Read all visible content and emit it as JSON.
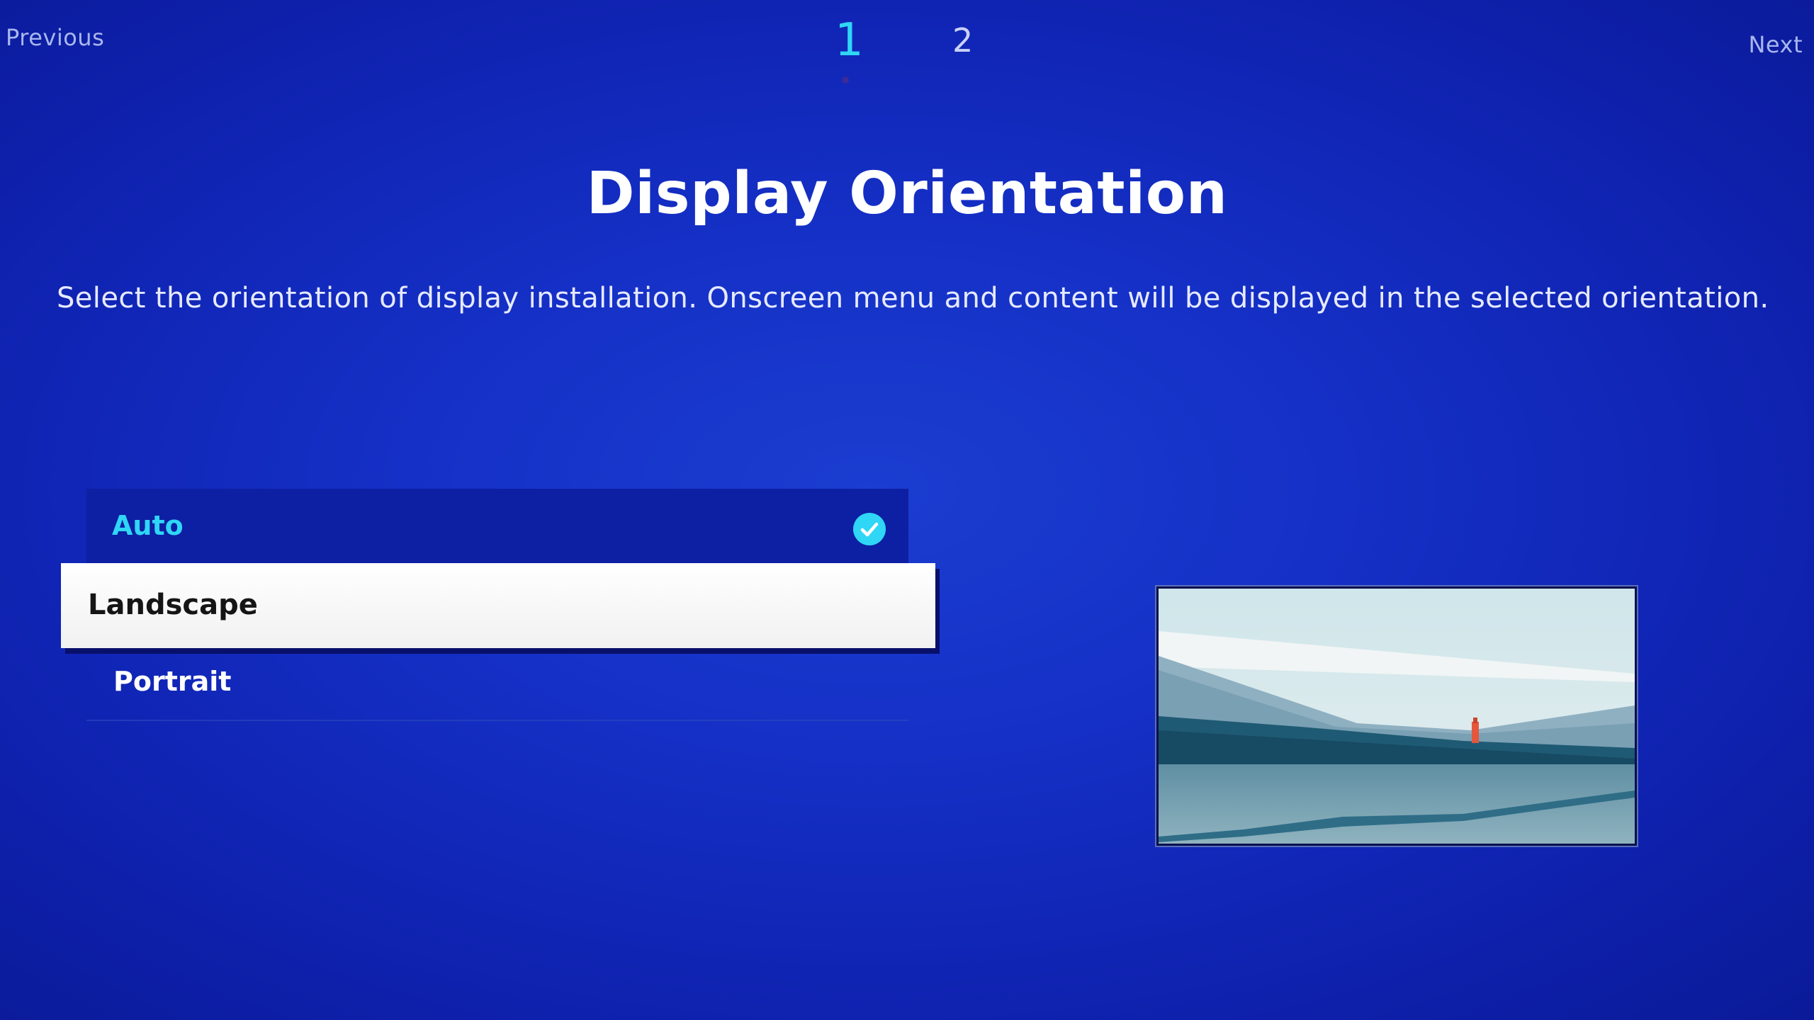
{
  "nav": {
    "previous_label": "Previous",
    "next_label": "Next"
  },
  "steps": {
    "current": "1",
    "next": "2"
  },
  "title": "Display Orientation",
  "description": "Select the orientation of display installation. Onscreen menu and content will be displayed in the selected orientation.",
  "options": [
    {
      "label": "Auto",
      "state": "selected",
      "icon": "check-circle-icon"
    },
    {
      "label": "Landscape",
      "state": "focused"
    },
    {
      "label": "Portrait",
      "state": "normal"
    }
  ],
  "preview": {
    "icon": "landscape-preview-image"
  },
  "colors": {
    "background": "#1530c6",
    "accent": "#2fd6f5",
    "focus_bg": "#ffffff",
    "selected_bg": "#0d1fa3"
  }
}
